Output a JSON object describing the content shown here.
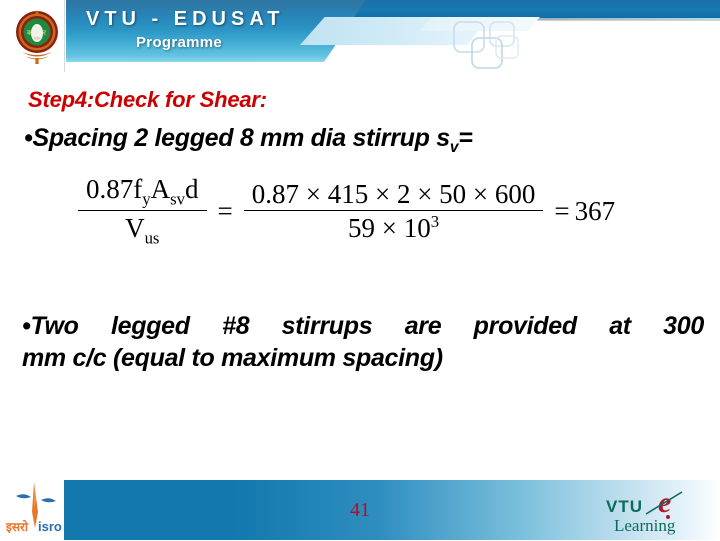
{
  "header": {
    "title": "VTU - EDUSAT",
    "subtitle": "Programme",
    "emblem_icon": "vtu-circular-emblem-icon",
    "deco_icon": "rounded-squares-decoration-icon"
  },
  "slide": {
    "step_title": "Step4:Check for Shear:",
    "bullet1": {
      "bullet": "•",
      "text_before": "Spacing 2 legged 8 mm dia stirrup s",
      "subscript": "v",
      "text_after": "="
    },
    "equation": {
      "lhs": {
        "numerator_a": "0.87f",
        "numerator_a_sub": "y",
        "numerator_b": "A",
        "numerator_b_sub": "sv",
        "numerator_c": "d",
        "denominator": "V",
        "denominator_sub": "us"
      },
      "equals_1": "=",
      "rhs": {
        "numerator": "0.87 × 415 × 2 × 50 × 600",
        "denominator_base": "59 × 10",
        "denominator_exponent": "3"
      },
      "equals_2": "=",
      "result": "367"
    },
    "bullet2": {
      "line1": "•Two legged #8 stirrups are provided at 300",
      "line2": "mm c/c (equal to maximum spacing)"
    }
  },
  "footer": {
    "page_number": "41",
    "isro_logo_icon": "isro-logo-icon",
    "isro_text_hindi": "इसरो",
    "isro_text_latin": "isro",
    "vtu_elearning": {
      "vtu": "VTU",
      "e": "e",
      "learning": "Learning"
    }
  },
  "colors": {
    "accent_red": "#cc0000",
    "banner_blue": "#1878b0",
    "page_number_red": "#b01020",
    "elearning_green": "#0d6b5c"
  }
}
